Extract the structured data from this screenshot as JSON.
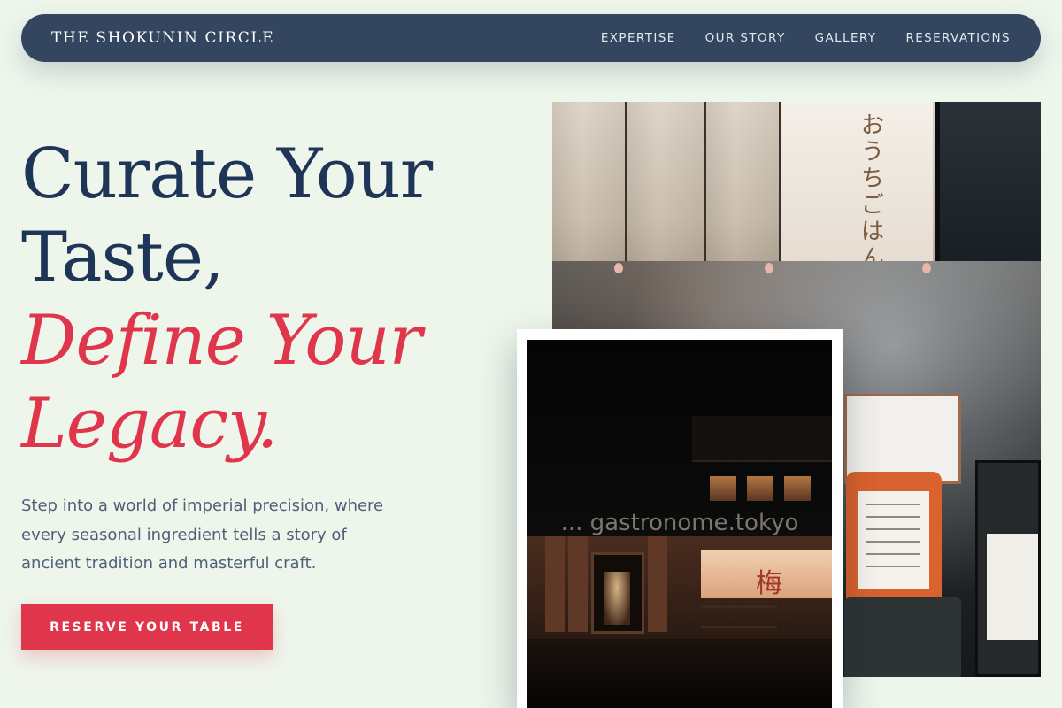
{
  "nav": {
    "brand": "THE SHOKUNIN CIRCLE",
    "links": [
      "EXPERTISE",
      "OUR STORY",
      "GALLERY",
      "RESERVATIONS"
    ]
  },
  "hero": {
    "headline_line1": "Curate Your",
    "headline_line2": "Taste,",
    "accent_line1": "Define Your",
    "accent_line2": "Legacy.",
    "subtitle": "Step into a world of imperial precision, where every seasonal ingredient tells a story of ancient tradition and masterful craft.",
    "cta_label": "RESERVE YOUR TABLE"
  },
  "gallery": {
    "front_watermark": "... gastronome.tokyo"
  },
  "colors": {
    "background": "#eef6ec",
    "navbar": "#33455f",
    "primary_text": "#1f3558",
    "accent": "#e0364b",
    "body_text": "#4f5f78"
  }
}
